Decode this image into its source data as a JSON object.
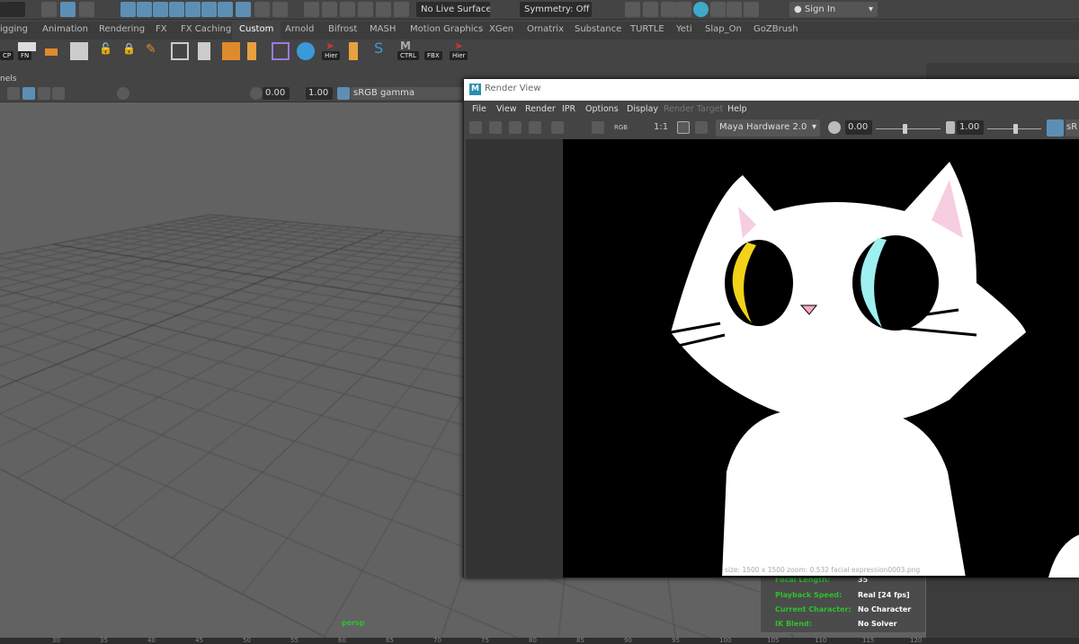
{
  "topbar": {
    "live_surface": "No Live Surface",
    "symmetry": "Symmetry: Off",
    "sign_in": "Sign In"
  },
  "shelf_tabs": [
    "igging",
    "Animation",
    "Rendering",
    "FX",
    "FX Caching",
    "Custom",
    "Arnold",
    "Bifrost",
    "MASH",
    "Motion Graphics",
    "XGen",
    "Ornatrix",
    "Substance",
    "TURTLE",
    "Yeti",
    "Slap_On",
    "GoZBrush"
  ],
  "shelf_active": "Custom",
  "shelf_labels": {
    "cp": "CP",
    "fn": "FN",
    "hier1": "Hier",
    "ctrl": "CTRL",
    "fbx": "FBX",
    "hier2": "Hier"
  },
  "viewport": {
    "panels_menu": "nels",
    "exposure": "0.00",
    "gamma": "1.00",
    "colorspace": "sRGB gamma",
    "camera": "persp"
  },
  "render_view": {
    "title": "Render View",
    "menu": [
      "File",
      "View",
      "Render",
      "IPR",
      "Options",
      "Display",
      "Render Target",
      "Help"
    ],
    "ratio": "1:1",
    "renderer": "Maya Hardware 2.0",
    "exposure": "0.00",
    "gamma": "1.00",
    "colorspace": "sR",
    "info": "size: 1500 x 1500 zoom: 0.532 facial expression0003.png"
  },
  "hud": [
    {
      "label": "Focal Length:",
      "value": "35"
    },
    {
      "label": "Playback Speed:",
      "value": "Real [24 fps]"
    },
    {
      "label": "Current Character:",
      "value": "No Character"
    },
    {
      "label": "IK Blend:",
      "value": "No Solver"
    }
  ],
  "timeline_ticks": [
    "30",
    "35",
    "40",
    "45",
    "50",
    "55",
    "60",
    "65",
    "70",
    "75",
    "80",
    "85",
    "90",
    "95",
    "100",
    "105",
    "110",
    "115",
    "120"
  ]
}
